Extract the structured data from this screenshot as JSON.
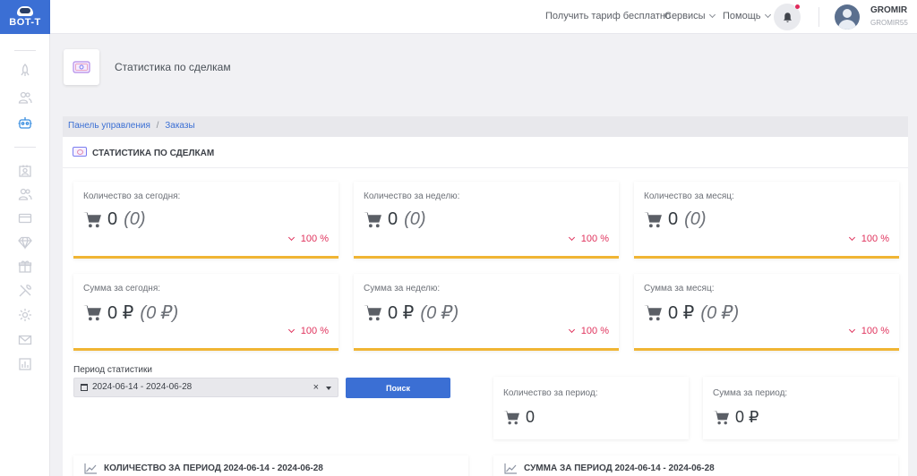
{
  "app": {
    "logo_text": "BOT-T"
  },
  "topbar": {
    "free_tariff": "Получить тариф бесплатно",
    "services": "Сервисы",
    "help": "Помощь",
    "user_name": "GROMIR",
    "user_login": "GROMIR55"
  },
  "page": {
    "title": "Статистика по сделкам"
  },
  "breadcrumb": {
    "items": [
      "Панель управления",
      "Заказы"
    ],
    "separator": "/"
  },
  "stats_card": {
    "title": "Статистика по сделкам"
  },
  "stats": [
    {
      "label": "Количество за сегодня:",
      "value": "0",
      "extra": "(0)",
      "change": "100 %"
    },
    {
      "label": "Количество за неделю:",
      "value": "0",
      "extra": "(0)",
      "change": "100 %"
    },
    {
      "label": "Количество за месяц:",
      "value": "0",
      "extra": "(0)",
      "change": "100 %"
    },
    {
      "label": "Сумма за сегодня:",
      "value": "0 ₽",
      "extra": "(0 ₽)",
      "change": "100 %"
    },
    {
      "label": "Сумма за неделю:",
      "value": "0 ₽",
      "extra": "(0 ₽)",
      "change": "100 %"
    },
    {
      "label": "Сумма за месяц:",
      "value": "0 ₽",
      "extra": "(0 ₽)",
      "change": "100 %"
    }
  ],
  "period": {
    "label": "Период статистики",
    "value": "2024-06-14 - 2024-06-28",
    "clear": "×",
    "search_button": "Поиск"
  },
  "period_totals": [
    {
      "label": "Количество за период:",
      "value": "0"
    },
    {
      "label": "Сумма за период:",
      "value": "0 ₽"
    }
  ],
  "bottom_cards": [
    {
      "title": "Количество за период 2024-06-14 - 2024-06-28"
    },
    {
      "title": "Сумма за период 2024-06-14 - 2024-06-28"
    }
  ],
  "colors": {
    "accent": "#3b6fd4",
    "card_border": "#f0b534",
    "negative": "#e0345e"
  }
}
